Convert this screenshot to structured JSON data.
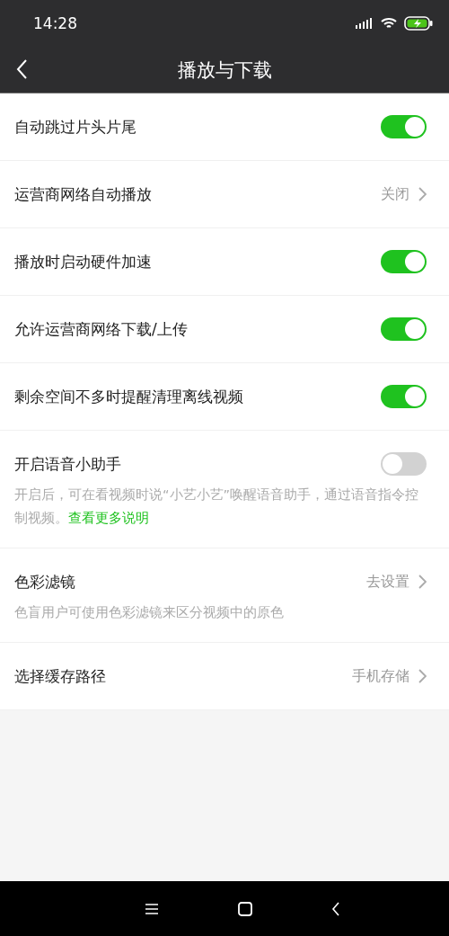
{
  "status_bar": {
    "time": "14:28"
  },
  "header": {
    "title": "播放与下载"
  },
  "settings": [
    {
      "kind": "toggle",
      "label": "自动跳过片头片尾",
      "on": true
    },
    {
      "kind": "link",
      "label": "运营商网络自动播放",
      "value": "关闭"
    },
    {
      "kind": "toggle",
      "label": "播放时启动硬件加速",
      "on": true
    },
    {
      "kind": "toggle",
      "label": "允许运营商网络下载/上传",
      "on": true
    },
    {
      "kind": "toggle",
      "label": "剩余空间不多时提醒清理离线视频",
      "on": true
    },
    {
      "kind": "toggle",
      "label": "开启语音小助手",
      "on": false,
      "description": "开启后，可在看视频时说“小艺小艺”唤醒语音助手，通过语音指令控制视频。",
      "description_link": "查看更多说明"
    },
    {
      "kind": "link",
      "label": "色彩滤镜",
      "value": "去设置",
      "description": "色盲用户可使用色彩滤镜来区分视频中的原色"
    },
    {
      "kind": "link",
      "label": "选择缓存路径",
      "value": "手机存储"
    }
  ]
}
